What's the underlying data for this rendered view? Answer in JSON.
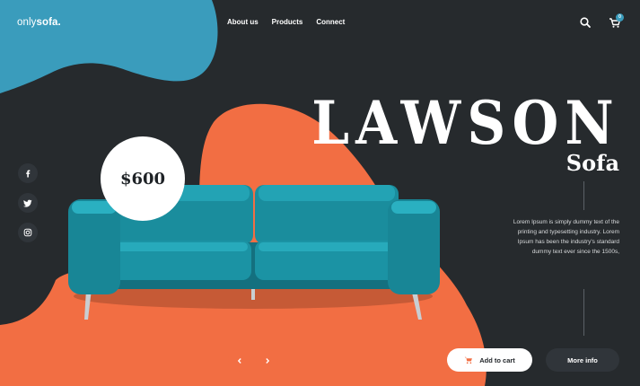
{
  "brand": {
    "name_prefix": "only",
    "name_suffix": "sofa."
  },
  "nav": [
    {
      "label": "About us"
    },
    {
      "label": "Products"
    },
    {
      "label": "Connect"
    }
  ],
  "header": {
    "cart_count": "0"
  },
  "hero": {
    "title": "LAWSON",
    "subtitle": "Sofa",
    "price": "$600",
    "description": "Lorem Ipsum is simply dummy text of the printing and typesetting industry. Lorem Ipsum has been the industry's standard dummy text ever since the 1500s,"
  },
  "actions": {
    "add_to_cart": "Add to cart",
    "more_info": "More info"
  },
  "social": [
    "facebook-icon",
    "twitter-icon",
    "instagram-icon"
  ],
  "icons": [
    "search-icon",
    "cart-icon",
    "chevron-left-icon",
    "chevron-right-icon"
  ],
  "colors": {
    "background": "#262a2d",
    "blue_blob": "#3a9cbc",
    "orange_blob": "#f26e43",
    "sofa": "#1c8fa0"
  }
}
